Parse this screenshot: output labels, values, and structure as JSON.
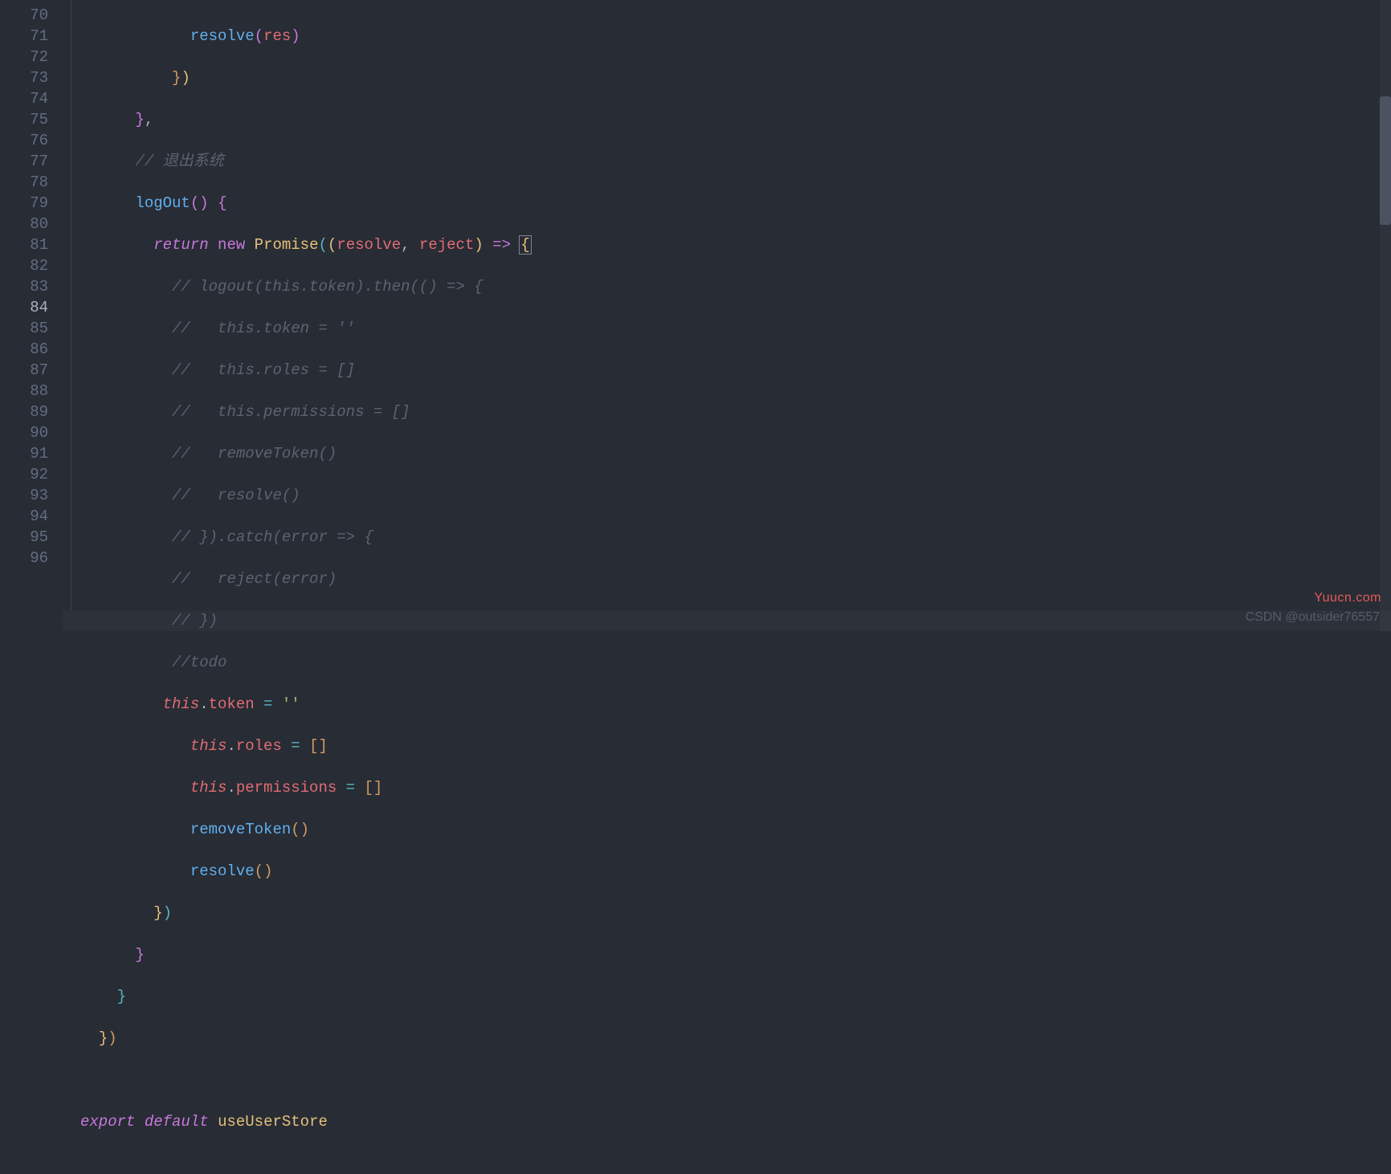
{
  "lineStart": 70,
  "lineEnd": 96,
  "activeLine": 84,
  "tokens": {
    "resolve": "resolve",
    "res": "res",
    "logOut": "logOut",
    "return": "return",
    "new": "new",
    "Promise": "Promise",
    "reject": "reject",
    "this": "this",
    "token": "token",
    "roles": "roles",
    "permissions": "permissions",
    "removeToken": "removeToken",
    "export": "export",
    "default": "default",
    "useUserStore": "useUserStore",
    "emptyStr": "''",
    "brackets": "[]",
    "arrow": "=>",
    "assign": "=",
    "dot": ".",
    "comma": ",",
    "brace_o": "{",
    "brace_c": "}",
    "paren_o": "(",
    "paren_c": ")"
  },
  "comments": {
    "exitSys": "// 退出系统",
    "c1": "// logout(this.token).then(() => {",
    "c2": "//   this.token = ''",
    "c3": "//   this.roles = []",
    "c4": "//   this.permissions = []",
    "c5": "//   removeToken()",
    "c6": "//   resolve()",
    "c7": "// }).catch(error => {",
    "c8": "//   reject(error)",
    "c9": "// })",
    "todo": "//todo"
  },
  "watermarkRight": "Yuucn.com",
  "watermarkCSDN": "CSDN @outsider76557"
}
